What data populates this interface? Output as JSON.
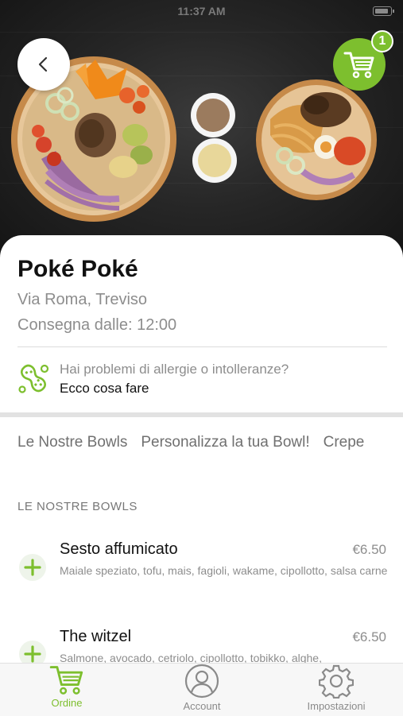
{
  "status_bar": {
    "time": "11:37 AM"
  },
  "header": {
    "back_icon": "chevron-left-icon",
    "cart_icon": "shopping-cart-icon",
    "cart_count": "1"
  },
  "restaurant": {
    "name": "Poké Poké",
    "address": "Via Roma, Treviso",
    "delivery": "Consegna dalle: 12:00"
  },
  "allergy": {
    "icon": "peanut-icon",
    "question": "Hai problemi di allergie o intolleranze?",
    "action": "Ecco cosa fare"
  },
  "tabs": [
    "Le Nostre Bowls",
    "Personalizza la tua Bowl!",
    "Crepe"
  ],
  "section_title": "LE NOSTRE BOWLS",
  "items": [
    {
      "name": "Sesto affumicato",
      "price": "€6.50",
      "description": "Maiale speziato, tofu, mais, fagioli, wakame, cipollotto, salsa carne"
    },
    {
      "name": "The witzel",
      "price": "€6.50",
      "description": "Salmone, avocado, cetriolo, cipollotto, tobikko, alghe,"
    }
  ],
  "bottom_nav": [
    {
      "label": "Ordine",
      "icon": "shopping-cart-icon",
      "active": true
    },
    {
      "label": "Account",
      "icon": "user-icon",
      "active": false
    },
    {
      "label": "Impostazioni",
      "icon": "gear-icon",
      "active": false
    }
  ],
  "colors": {
    "accent": "#7dbf2e",
    "muted_text": "#8d8d8d",
    "inactive_nav": "#8a8a8a"
  }
}
